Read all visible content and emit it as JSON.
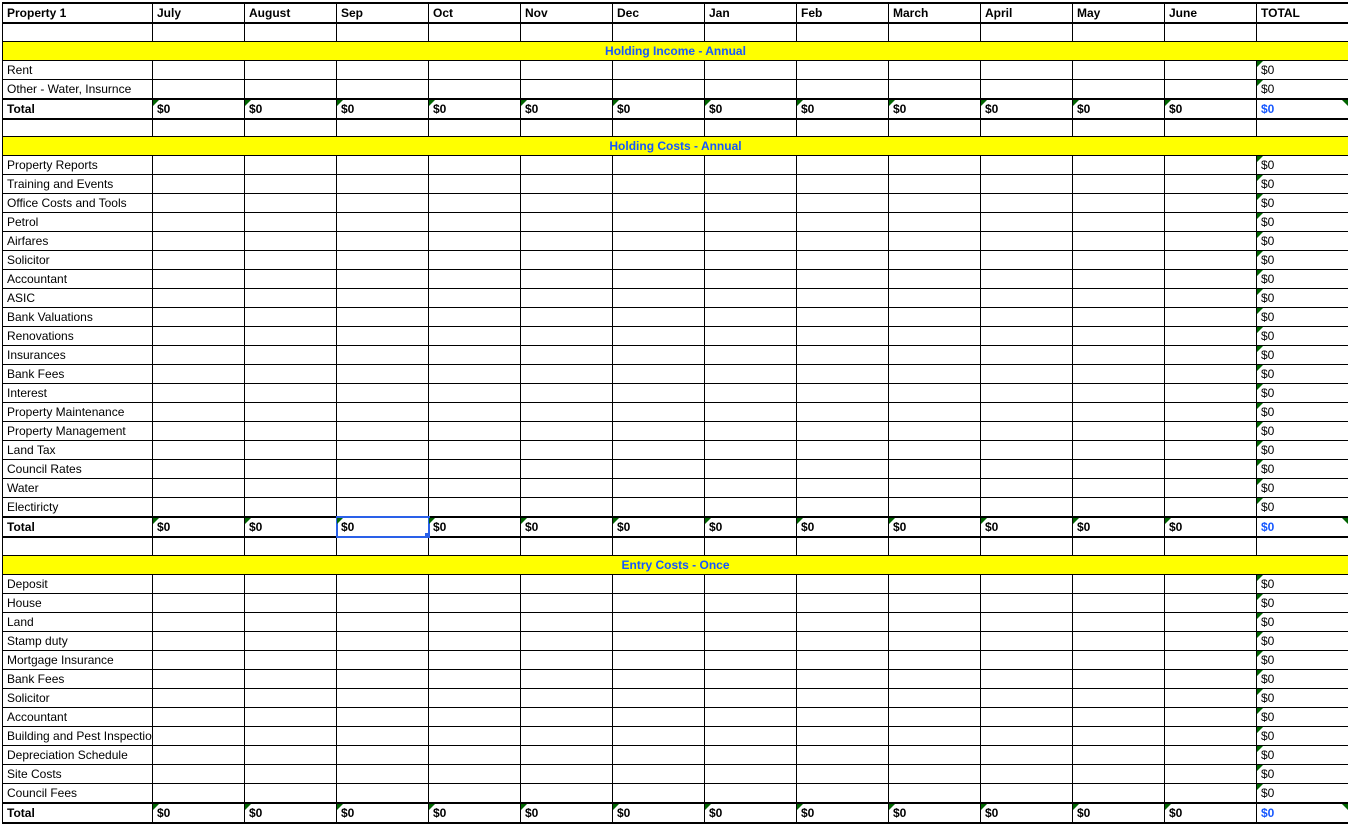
{
  "header": {
    "property": "Property 1",
    "months": [
      "July",
      "August",
      "Sep",
      "Oct",
      "Nov",
      "Dec",
      "Jan",
      "Feb",
      "March",
      "April",
      "May",
      "June"
    ],
    "total": "TOTAL"
  },
  "sections": [
    {
      "title": "Holding Income - Annual",
      "rows": [
        {
          "label": "Rent",
          "total": "$0"
        },
        {
          "label": "Other - Water, Insurnce",
          "total": "$0"
        }
      ],
      "total": {
        "label": "Total",
        "months": [
          "$0",
          "$0",
          "$0",
          "$0",
          "$0",
          "$0",
          "$0",
          "$0",
          "$0",
          "$0",
          "$0",
          "$0"
        ],
        "total": "$0"
      }
    },
    {
      "title": "Holding Costs - Annual",
      "rows": [
        {
          "label": "Property Reports",
          "total": "$0"
        },
        {
          "label": "Training and Events",
          "total": "$0"
        },
        {
          "label": "Office Costs and Tools",
          "total": "$0"
        },
        {
          "label": "Petrol",
          "total": "$0"
        },
        {
          "label": "Airfares",
          "total": "$0"
        },
        {
          "label": "Solicitor",
          "total": "$0"
        },
        {
          "label": "Accountant",
          "total": "$0"
        },
        {
          "label": "ASIC",
          "total": "$0"
        },
        {
          "label": "Bank Valuations",
          "total": "$0"
        },
        {
          "label": "Renovations",
          "total": "$0"
        },
        {
          "label": "Insurances",
          "total": "$0"
        },
        {
          "label": "Bank Fees",
          "total": "$0"
        },
        {
          "label": "Interest",
          "total": "$0"
        },
        {
          "label": "Property Maintenance",
          "total": "$0"
        },
        {
          "label": "Property Management",
          "total": "$0"
        },
        {
          "label": "Land Tax",
          "total": "$0"
        },
        {
          "label": "Council Rates",
          "total": "$0"
        },
        {
          "label": "Water",
          "total": "$0"
        },
        {
          "label": "Electiricty",
          "total": "$0"
        }
      ],
      "total": {
        "label": "Total",
        "months": [
          "$0",
          "$0",
          "$0",
          "$0",
          "$0",
          "$0",
          "$0",
          "$0",
          "$0",
          "$0",
          "$0",
          "$0"
        ],
        "total": "$0"
      }
    },
    {
      "title": "Entry Costs - Once",
      "rows": [
        {
          "label": "Deposit",
          "total": "$0"
        },
        {
          "label": "House",
          "total": "$0"
        },
        {
          "label": "Land",
          "total": "$0"
        },
        {
          "label": "Stamp duty",
          "total": "$0"
        },
        {
          "label": "Mortgage Insurance",
          "total": "$0"
        },
        {
          "label": "Bank Fees",
          "total": "$0"
        },
        {
          "label": "Solicitor",
          "total": "$0"
        },
        {
          "label": "Accountant",
          "total": "$0"
        },
        {
          "label": "Building and Pest Inspection",
          "total": "$0"
        },
        {
          "label": "Depreciation Schedule",
          "total": "$0"
        },
        {
          "label": "Site Costs",
          "total": "$0"
        },
        {
          "label": "Council Fees",
          "total": "$0"
        }
      ],
      "total": {
        "label": "Total",
        "months": [
          "$0",
          "$0",
          "$0",
          "$0",
          "$0",
          "$0",
          "$0",
          "$0",
          "$0",
          "$0",
          "$0",
          "$0"
        ],
        "total": "$0"
      }
    }
  ],
  "selected_cell": {
    "section": 1,
    "total_month_index": 2
  }
}
